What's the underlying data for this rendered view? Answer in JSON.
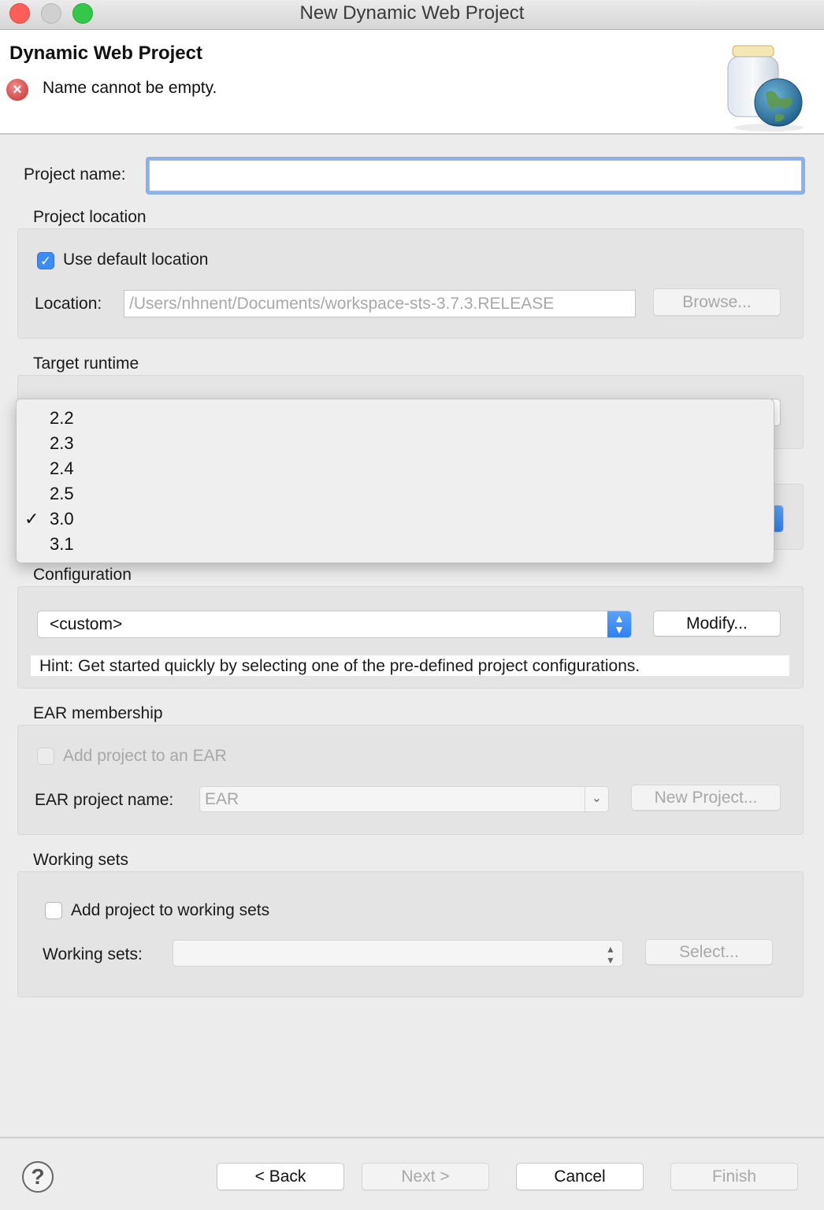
{
  "window": {
    "title": "New Dynamic Web Project"
  },
  "banner": {
    "title": "Dynamic Web Project",
    "error_message": "Name cannot be empty."
  },
  "project_name": {
    "label": "Project name:",
    "value": ""
  },
  "project_location": {
    "group_label": "Project location",
    "use_default_label": "Use default location",
    "use_default_checked": true,
    "location_label": "Location:",
    "location_value": "/Users/nhnent/Documents/workspace-sts-3.7.3.RELEASE",
    "browse_label": "Browse..."
  },
  "target_runtime": {
    "group_label": "Target runtime"
  },
  "module_version_popup": {
    "options": [
      "2.2",
      "2.3",
      "2.4",
      "2.5",
      "3.0",
      "3.1"
    ],
    "selected": "3.0",
    "check_mark": "✓"
  },
  "configuration": {
    "group_label": "Configuration",
    "selected": "<custom>",
    "modify_label": "Modify...",
    "hint": "Hint: Get started quickly by selecting one of the pre-defined project configurations."
  },
  "ear_membership": {
    "group_label": "EAR membership",
    "add_label": "Add project to an EAR",
    "ear_name_label": "EAR project name:",
    "ear_name_value": "EAR",
    "new_project_label": "New Project..."
  },
  "working_sets": {
    "group_label": "Working sets",
    "add_label": "Add project to working sets",
    "sets_label": "Working sets:",
    "sets_value": "",
    "select_label": "Select..."
  },
  "footer": {
    "help_glyph": "?",
    "back_label": "< Back",
    "next_label": "Next >",
    "cancel_label": "Cancel",
    "finish_label": "Finish"
  },
  "colors": {
    "accent": "#3c8cf5",
    "error": "#c9302c",
    "focus_ring": "#8cb1e8"
  }
}
